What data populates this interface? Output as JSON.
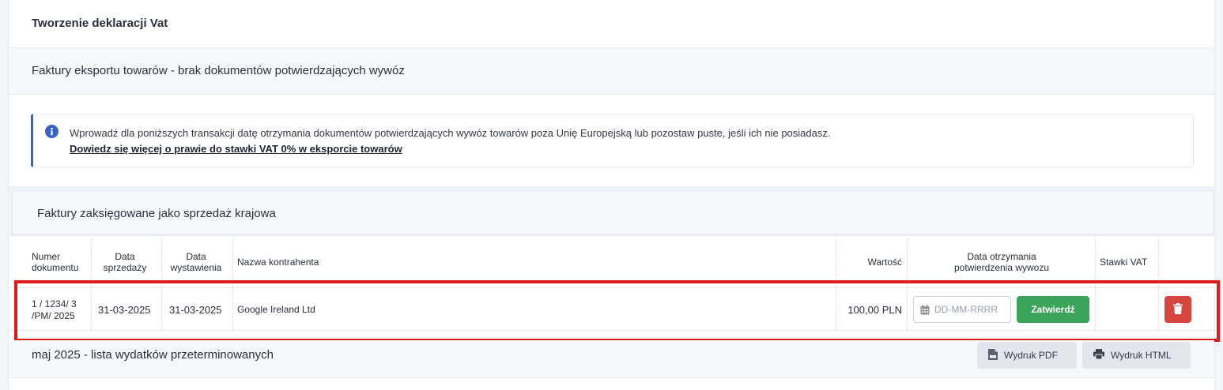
{
  "header": {
    "title": "Tworzenie deklaracji Vat"
  },
  "export_section": {
    "title": "Faktury eksportu towarów - brak dokumentów potwierdzających wywóz"
  },
  "info": {
    "text": "Wprowadź dla poniższych transakcji datę otrzymania dokumentów potwierdzających wywóz towarów poza Unię Europejską lub pozostaw puste, jeśli ich nie posiadasz.",
    "link": "Dowiedz się więcej o prawie do stawki VAT 0% w eksporcie towarów",
    "icon": "info-icon",
    "accent": "#3a63c8"
  },
  "domestic_section": {
    "title": "Faktury zaksięgowane jako sprzedaż krajowa"
  },
  "table": {
    "headers": {
      "doc_number": [
        "Numer",
        "dokumentu"
      ],
      "sale_date": [
        "Data",
        "sprzedaży"
      ],
      "issue_date": [
        "Data",
        "wystawienia"
      ],
      "contractor": "Nazwa kontrahenta",
      "value": "Wartość",
      "confirm_date": [
        "Data otrzymania",
        "potwierdzenia wywozu"
      ],
      "vat_rates": "Stawki VAT"
    },
    "rows": [
      {
        "doc_number": [
          "1 / 1234/ 3",
          "/PM/ 2025"
        ],
        "sale_date": "31-03-2025",
        "issue_date": "31-03-2025",
        "contractor": "Google Ireland Ltd",
        "value": "100,00 PLN",
        "date_value": "",
        "date_placeholder": "DD-MM-RRRR",
        "confirm_label": "Zatwierdź",
        "vat_rates": ""
      }
    ]
  },
  "expenses_section": {
    "title": "maj 2025 - lista wydatków przeterminowanych",
    "pdf_label": "Wydruk PDF",
    "html_label": "Wydruk HTML"
  },
  "colors": {
    "confirm": "#3aa55a",
    "delete": "#d6453d",
    "highlight": "#e01b1b"
  }
}
